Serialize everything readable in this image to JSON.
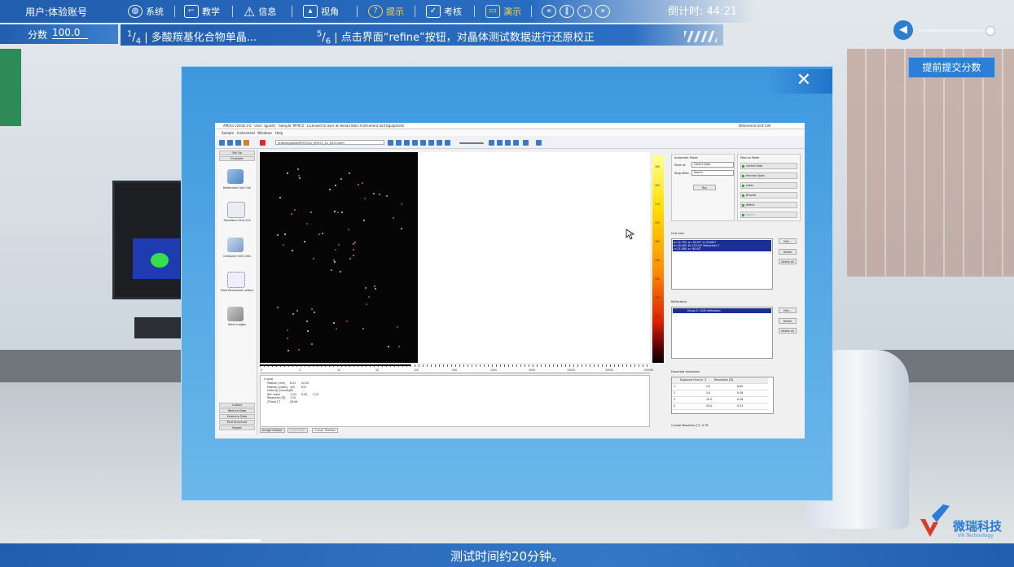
{
  "header": {
    "user_label": "用户:体验账号",
    "menu": [
      {
        "label": "系统",
        "icon": "globe-icon"
      },
      {
        "label": "教学",
        "icon": "teaching-icon"
      },
      {
        "label": "信息",
        "icon": "warning-icon"
      },
      {
        "label": "视角",
        "icon": "image-icon"
      },
      {
        "label": "提示",
        "icon": "help-icon",
        "active": true
      },
      {
        "label": "考核",
        "icon": "clipboard-icon"
      },
      {
        "label": "演示",
        "icon": "monitor-icon",
        "active": true
      }
    ],
    "media_controls": [
      "rewind-icon",
      "pause-icon",
      "play-icon",
      "fast-forward-icon"
    ],
    "countdown_label": "倒计时:",
    "countdown_value": "44:21"
  },
  "score": {
    "label": "分数",
    "value": "100.0"
  },
  "steps": {
    "current_num": "1",
    "current_den": "4",
    "current_text": "多酸羰基化合物单晶...",
    "sub_num": "5",
    "sub_den": "6",
    "sub_text": "点击界面“refine”按钮，对晶体测试数据进行还原校正"
  },
  "audio": {
    "volume": 1.0
  },
  "submit_button": "提前提交分数",
  "modal": {
    "close_glyph": "✕",
    "app": {
      "title": "APEX3 v2018.1-0 · User: (guest) · Sample: MY972 · Licensed to User at Henan Kelin Instrument and Equipment",
      "right_title": "Determine Unit Cell",
      "menu": [
        "Sample",
        "Instrument",
        "Windows",
        "Help"
      ],
      "path": "/frames/guest/MY972/sc_MY972_01_0074.sfrm",
      "sidebar_top": [
        "Set Up",
        "Evaluate"
      ],
      "sidebar_tools": [
        "Determine Unit Cell",
        "Transform Unit Cell",
        "Compare Unit Cells",
        "View Reciprocal Lattice",
        "View Images"
      ],
      "sidebar_bottom": [
        "Collect",
        "Reduce Data",
        "Examine Data",
        "Find Structure",
        "Report"
      ],
      "colorbar_ticks": [
        "180",
        "160",
        "170",
        "150",
        "160",
        "140",
        "130",
        "120",
        "110",
        "100"
      ],
      "ruler_ticks": [
        "0",
        "5",
        "10",
        "50",
        "100",
        "500",
        "1000",
        "5000",
        "10000",
        "50000",
        "100000"
      ],
      "cursor": {
        "title": "Cursor",
        "rows": [
          [
            "Position [mm]",
            "8.25",
            "22.00"
          ],
          [
            "Position [pixels]",
            "445",
            "674"
          ],
          [
            "Intensity [counts]",
            "65",
            ""
          ],
          [
            "HKL index",
            "-0.02",
            "8.90",
            "2.10"
          ],
          [
            "Resolution [Å]",
            "1.50",
            ""
          ],
          [
            "2Theta [°]",
            "28.06",
            ""
          ]
        ]
      },
      "tabs": [
        "Image Header",
        "Unit Editor",
        "Cursor Position"
      ],
      "automatic_mode": {
        "title": "Automatic Mode",
        "start_label": "Start at:",
        "start_value": "Collect Data",
        "stop_label": "Stop after:",
        "stop_value": "Search",
        "run": "Run"
      },
      "manual_mode": {
        "title": "Manual Mode",
        "buttons": [
          "Collect Data",
          "Harvest Spots",
          "Index",
          "Bravais",
          "Refine",
          "Search"
        ]
      },
      "unit_cells": {
        "title": "Unit cells",
        "selected": [
          "a=12.795, α= 90.00° V=310697",
          "b=16.363, β=110.44° Monoclinic C",
          "c=21.598, γ= 90.00°"
        ],
        "buttons": [
          "Edit...",
          "Delete",
          "Delete All"
        ]
      },
      "reflections": {
        "title": "Reflections",
        "selected": "Group 0: 1435 reflections",
        "buttons": [
          "Edit...",
          "Delete",
          "Delete All"
        ]
      },
      "expected_resolution": {
        "title": "Expected resolution",
        "headers": [
          "Exposure time [s⁻¹]",
          "Resolution [Å]"
        ],
        "rows": [
          [
            "1",
            "2.0",
            "0.62"
          ],
          [
            "2",
            "5.0",
            "0.58"
          ],
          [
            "3",
            "10.0",
            "0.56"
          ],
          [
            "4",
            "20.0",
            "0.53"
          ]
        ]
      },
      "crystal_mosaicity": "Crystal Mosaicity [°]: 0.78"
    }
  },
  "subtitle": "测试时间约20分钟。",
  "logo": {
    "name": "微瑞科技",
    "sub": "VR Technology"
  }
}
